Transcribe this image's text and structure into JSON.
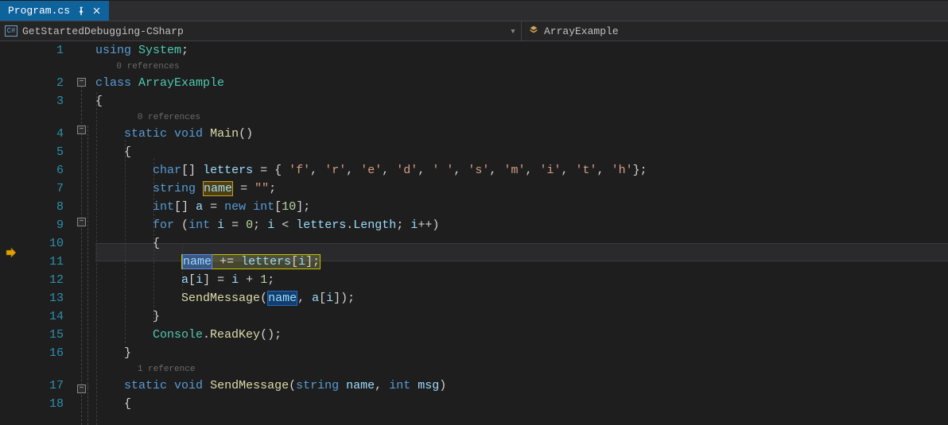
{
  "tab": {
    "title": "Program.cs"
  },
  "breadcrumb": {
    "left_icon_text": "C#",
    "left": "GetStartedDebugging-CSharp",
    "right": "ArrayExample"
  },
  "codelens": {
    "class_refs": "0 references",
    "main_refs": "0 references",
    "send_refs": "1 reference"
  },
  "code": {
    "l1": "using System;",
    "l2": "class ArrayExample",
    "l3": "{",
    "l4": "    static void Main()",
    "l5": "    {",
    "l6": "        char[] letters = { 'f', 'r', 'e', 'd', ' ', 's', 'm', 'i', 't', 'h'};",
    "l7": "        string name = \"\";",
    "l8": "        int[] a = new int[10];",
    "l9": "        for (int i = 0; i < letters.Length; i++)",
    "l10": "        {",
    "l11": "            name += letters[i];",
    "l12": "            a[i] = i + 1;",
    "l13": "            SendMessage(name, a[i]);",
    "l14": "        }",
    "l15": "        Console.ReadKey();",
    "l16": "    }",
    "l17": "    static void SendMessage(string name, int msg)",
    "l18": "    {"
  },
  "tokens": {
    "using": "using",
    "System": "System",
    "class": "class",
    "ArrayExample": "ArrayExample",
    "static": "static",
    "void": "void",
    "Main": "Main",
    "char": "char",
    "letters": "letters",
    "lit_f": "'f'",
    "lit_r": "'r'",
    "lit_e": "'e'",
    "lit_d": "'d'",
    "lit_sp": "' '",
    "lit_s": "'s'",
    "lit_m": "'m'",
    "lit_i": "'i'",
    "lit_t": "'t'",
    "lit_h": "'h'",
    "string": "string",
    "name": "name",
    "emptystr": "\"\"",
    "int": "int",
    "a": "a",
    "new": "new",
    "ten": "10",
    "for": "for",
    "i": "i",
    "zero": "0",
    "Length": "Length",
    "ipp": "++",
    "pluseq": "+=",
    "one": "1",
    "SendMessage": "SendMessage",
    "Console": "Console",
    "ReadKey": "ReadKey",
    "msg": "msg"
  },
  "line_numbers": [
    "1",
    "2",
    "3",
    "4",
    "5",
    "6",
    "7",
    "8",
    "9",
    "10",
    "11",
    "12",
    "13",
    "14",
    "15",
    "16",
    "17",
    "18"
  ],
  "current_line_index": 11
}
